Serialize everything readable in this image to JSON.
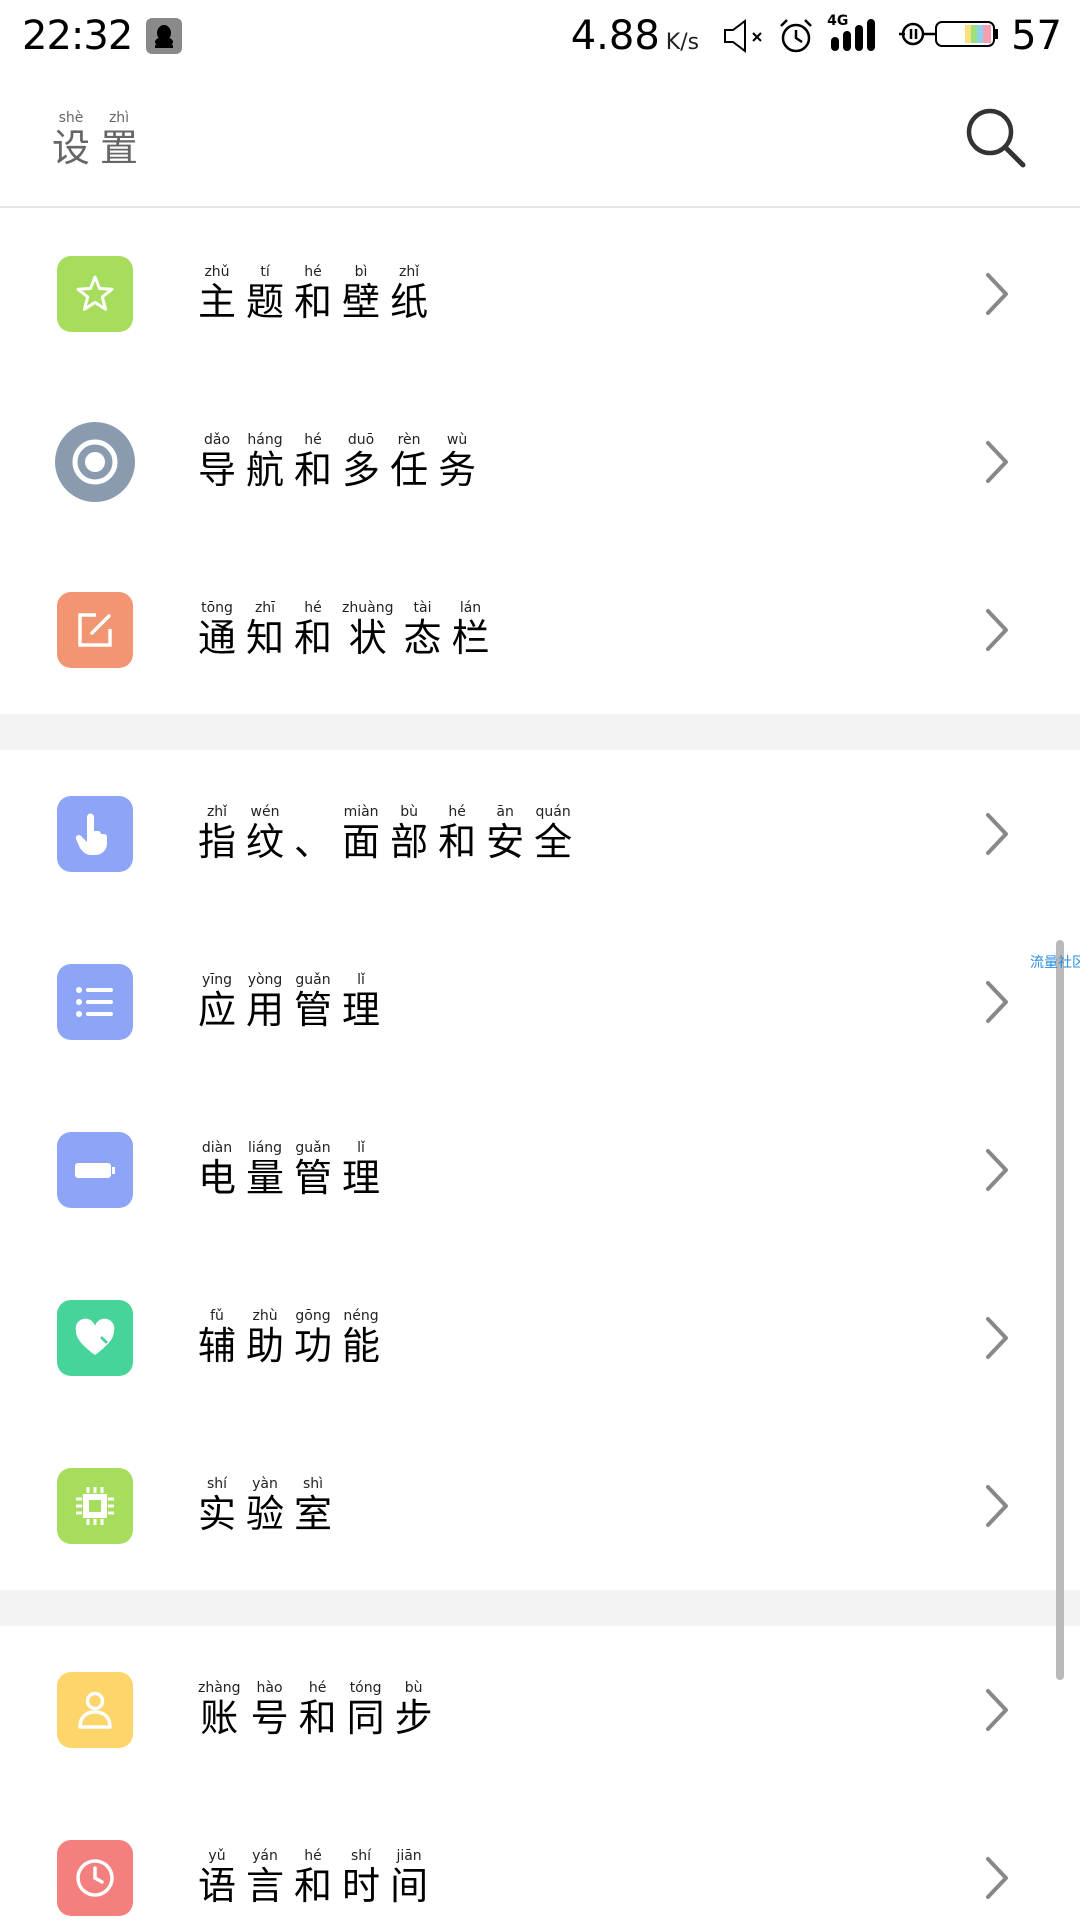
{
  "status_bar": {
    "time": "22:32",
    "net_speed": "4.88",
    "net_speed_unit": "K/s",
    "network_type": "4G",
    "battery": "57",
    "icons": [
      "qq-icon",
      "mute-icon",
      "alarm-icon",
      "signal-icon",
      "charging-icon",
      "battery-icon"
    ]
  },
  "header": {
    "title": [
      {
        "py": "shè",
        "hz": "设"
      },
      {
        "py": "zhì",
        "hz": "置"
      }
    ],
    "search_icon": "search-icon"
  },
  "sections": [
    {
      "items": [
        {
          "id": "theme",
          "icon": "star-icon",
          "color": "#a6dd5c",
          "label": [
            {
              "py": "zhǔ",
              "hz": "主"
            },
            {
              "py": "tí",
              "hz": "题"
            },
            {
              "py": "hé",
              "hz": "和"
            },
            {
              "py": "bì",
              "hz": "壁"
            },
            {
              "py": "zhǐ",
              "hz": "纸"
            }
          ]
        },
        {
          "id": "navigation",
          "icon": "target-icon",
          "color": "#8a9bb0",
          "label": [
            {
              "py": "dǎo",
              "hz": "导"
            },
            {
              "py": "háng",
              "hz": "航"
            },
            {
              "py": "hé",
              "hz": "和"
            },
            {
              "py": "duō",
              "hz": "多"
            },
            {
              "py": "rèn",
              "hz": "任"
            },
            {
              "py": "wù",
              "hz": "务"
            }
          ]
        },
        {
          "id": "notifications",
          "icon": "edit-icon",
          "color": "#f29572",
          "label": [
            {
              "py": "tōng",
              "hz": "通"
            },
            {
              "py": "zhī",
              "hz": "知"
            },
            {
              "py": "hé",
              "hz": "和"
            },
            {
              "py": "zhuàng",
              "hz": "状"
            },
            {
              "py": "tài",
              "hz": "态"
            },
            {
              "py": "lán",
              "hz": "栏"
            }
          ]
        }
      ]
    },
    {
      "items": [
        {
          "id": "security",
          "icon": "hand-icon",
          "color": "#8ea5f7",
          "label": [
            {
              "py": "zhǐ",
              "hz": "指"
            },
            {
              "py": "wén",
              "hz": "纹"
            },
            {
              "py": "",
              "hz": "、"
            },
            {
              "py": "miàn",
              "hz": "面"
            },
            {
              "py": "bù",
              "hz": "部"
            },
            {
              "py": "hé",
              "hz": "和"
            },
            {
              "py": "ān",
              "hz": "安"
            },
            {
              "py": "quán",
              "hz": "全"
            }
          ]
        },
        {
          "id": "apps",
          "icon": "list-icon",
          "color": "#8ea5f7",
          "label": [
            {
              "py": "yīng",
              "hz": "应"
            },
            {
              "py": "yòng",
              "hz": "用"
            },
            {
              "py": "guǎn",
              "hz": "管"
            },
            {
              "py": "lǐ",
              "hz": "理"
            }
          ]
        },
        {
          "id": "battery",
          "icon": "battery-icon",
          "color": "#8ea5f7",
          "label": [
            {
              "py": "diàn",
              "hz": "电"
            },
            {
              "py": "liáng",
              "hz": "量"
            },
            {
              "py": "guǎn",
              "hz": "管"
            },
            {
              "py": "lǐ",
              "hz": "理"
            }
          ]
        },
        {
          "id": "accessibility",
          "icon": "heart-icon",
          "color": "#46d49a",
          "label": [
            {
              "py": "fǔ",
              "hz": "辅"
            },
            {
              "py": "zhù",
              "hz": "助"
            },
            {
              "py": "gōng",
              "hz": "功"
            },
            {
              "py": "néng",
              "hz": "能"
            }
          ]
        },
        {
          "id": "lab",
          "icon": "chip-icon",
          "color": "#a6dd5c",
          "label": [
            {
              "py": "shí",
              "hz": "实"
            },
            {
              "py": "yàn",
              "hz": "验"
            },
            {
              "py": "shì",
              "hz": "室"
            }
          ]
        }
      ]
    },
    {
      "items": [
        {
          "id": "account",
          "icon": "user-icon",
          "color": "#fdd56a",
          "label": [
            {
              "py": "zhàng",
              "hz": "账"
            },
            {
              "py": "hào",
              "hz": "号"
            },
            {
              "py": "hé",
              "hz": "和"
            },
            {
              "py": "tóng",
              "hz": "同"
            },
            {
              "py": "bù",
              "hz": "步"
            }
          ]
        },
        {
          "id": "language",
          "icon": "clock-icon",
          "color": "#f47f7f",
          "label": [
            {
              "py": "yǔ",
              "hz": "语"
            },
            {
              "py": "yán",
              "hz": "言"
            },
            {
              "py": "hé",
              "hz": "和"
            },
            {
              "py": "shí",
              "hz": "时"
            },
            {
              "py": "jiān",
              "hz": "间"
            }
          ]
        }
      ]
    }
  ],
  "overlay_text": "流量社区"
}
